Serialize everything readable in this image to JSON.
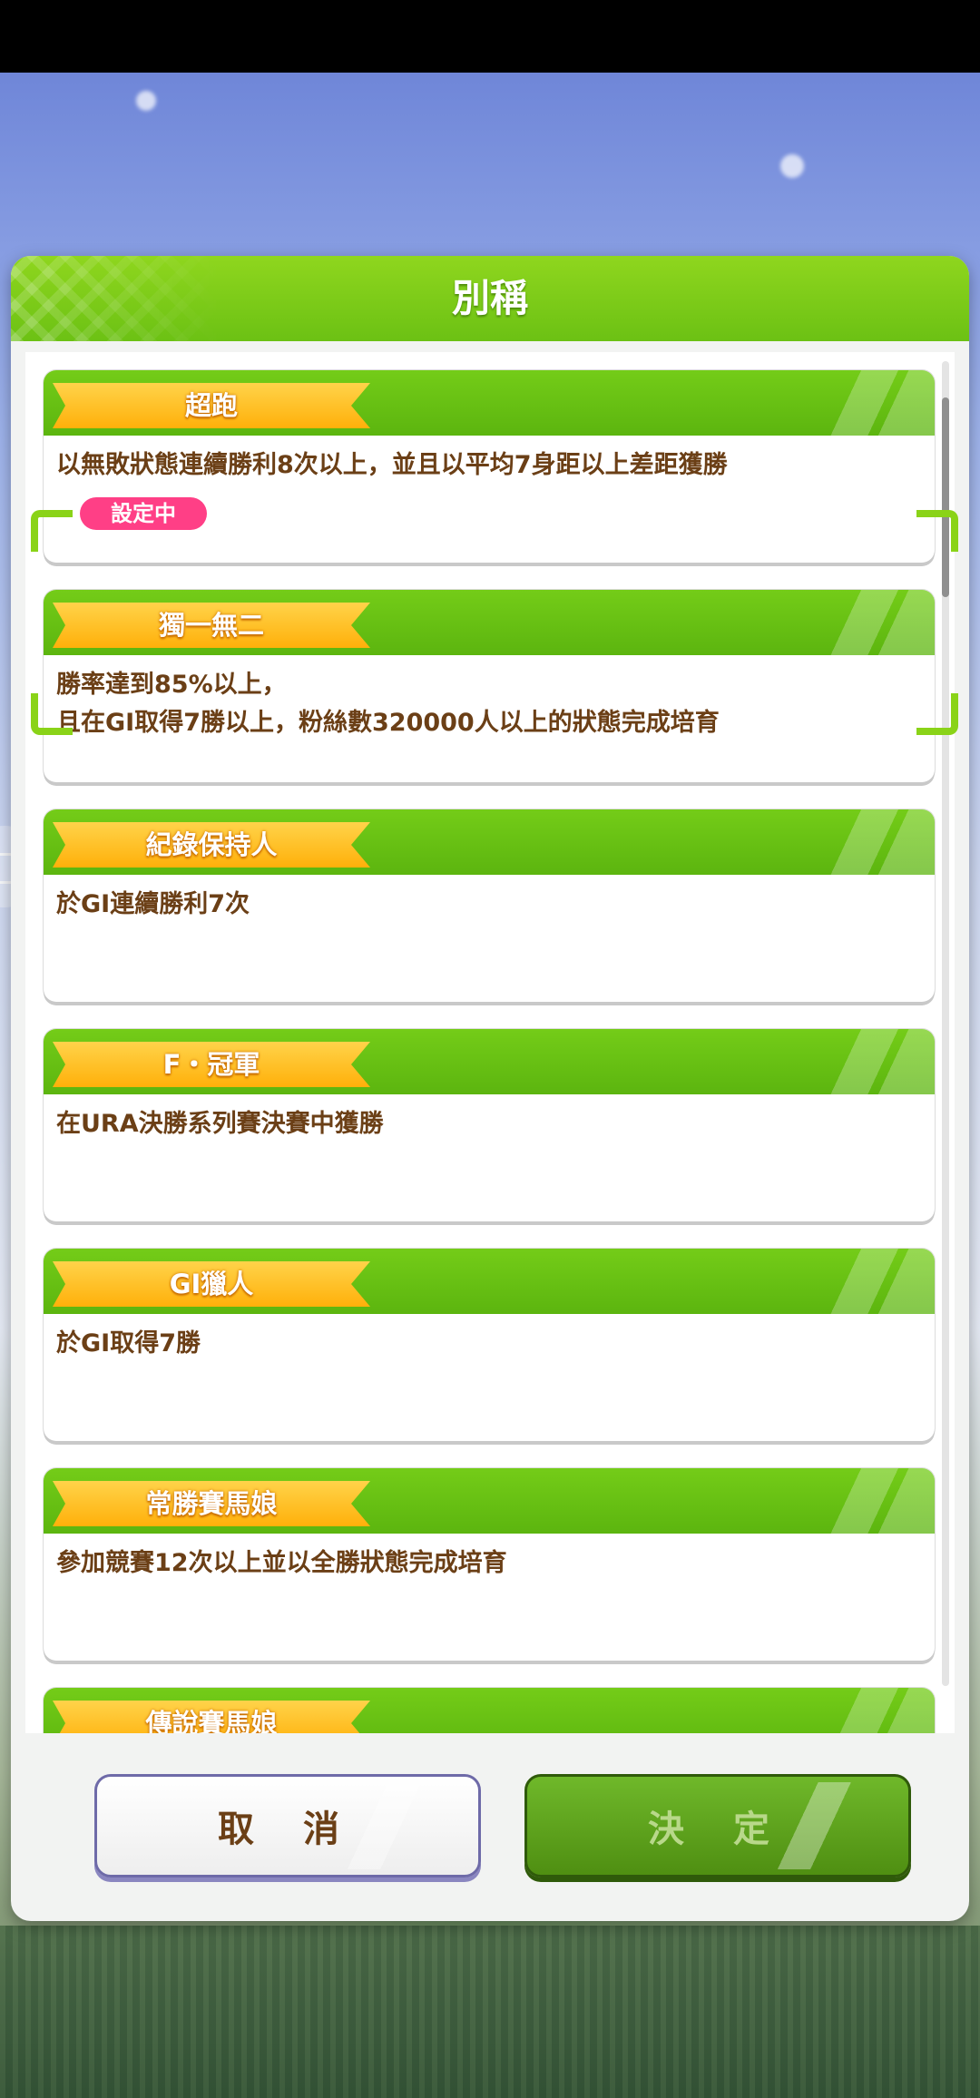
{
  "dialog": {
    "title": "別稱",
    "selected_badge": "設定中",
    "cancel_label": "取 消",
    "confirm_label": "決 定"
  },
  "titles": [
    {
      "name": "超跑",
      "description": "以無敗狀態連續勝利8次以上，並且以平均7身距以上差距獲勝"
    },
    {
      "name": "獨一無二",
      "description": "勝率達到85%以上，\n且在GⅠ取得7勝以上，粉絲數320000人以上的狀態完成培育"
    },
    {
      "name": "紀錄保持人",
      "description": "於GⅠ連續勝利7次"
    },
    {
      "name": "F・冠軍",
      "description": "在URA決勝系列賽決賽中獲勝"
    },
    {
      "name": "GⅠ獵人",
      "description": "於GⅠ取得7勝"
    },
    {
      "name": "常勝賽馬娘",
      "description": "參加競賽12次以上並以全勝狀態完成培育"
    },
    {
      "name": "傳說賽馬娘",
      "description": ""
    }
  ]
}
